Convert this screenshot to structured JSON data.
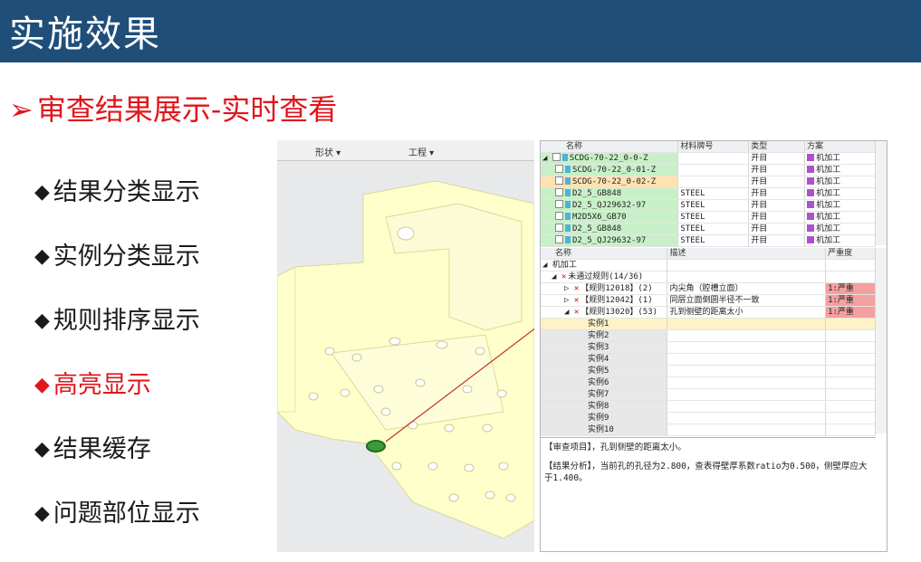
{
  "header": {
    "title": "实施效果"
  },
  "subtitle": {
    "arrow": "➢",
    "text": "审查结果展示-实时查看"
  },
  "bullets": [
    {
      "mark": "◆",
      "label": "结果分类显示",
      "active": false
    },
    {
      "mark": "◆",
      "label": "实例分类显示",
      "active": false
    },
    {
      "mark": "◆",
      "label": "规则排序显示",
      "active": false
    },
    {
      "mark": "◆",
      "label": "高亮显示",
      "active": true
    },
    {
      "mark": "◆",
      "label": "结果缓存",
      "active": false
    },
    {
      "mark": "◆",
      "label": "问题部位显示",
      "active": false
    }
  ],
  "cad": {
    "toolbar": [
      "形状 ▾",
      "工程 ▾"
    ]
  },
  "top_grid": {
    "headers": [
      "名称",
      "材料牌号",
      "类型",
      "方案"
    ],
    "rows": [
      {
        "name": "SCDG-70-22_0-0-Z",
        "material": "",
        "type": "开目",
        "plan": "机加工"
      },
      {
        "name": "SCDG-70-22_0-01-Z",
        "material": "",
        "type": "开目",
        "plan": "机加工"
      },
      {
        "name": "SCDG-70-22_0-02-Z",
        "material": "",
        "type": "开目",
        "plan": "机加工"
      },
      {
        "name": "D2_5_GB848",
        "material": "STEEL",
        "type": "开目",
        "plan": "机加工"
      },
      {
        "name": "D2_5_QJ29632-97",
        "material": "STEEL",
        "type": "开目",
        "plan": "机加工"
      },
      {
        "name": "M2D5X6_GB70",
        "material": "STEEL",
        "type": "开目",
        "plan": "机加工"
      },
      {
        "name": "D2_5_GB848",
        "material": "STEEL",
        "type": "开目",
        "plan": "机加工"
      },
      {
        "name": "D2_5_QJ29632-97",
        "material": "STEEL",
        "type": "开目",
        "plan": "机加工"
      }
    ]
  },
  "result_grid": {
    "headers": [
      "名称",
      "描述",
      "严重度"
    ],
    "group": "机加工",
    "subgroup": "未通过规则(14/36)",
    "rules": [
      {
        "name": "【规则12018】(2)",
        "desc": "内尖角（腔槽立面）",
        "severity": "1:严重"
      },
      {
        "name": "【规则12042】(1)",
        "desc": "同层立面倒圆半径不一致",
        "severity": "1:严重"
      },
      {
        "name": "【规则13020】(53)",
        "desc": "孔到侧壁的距离太小",
        "severity": "1:严重"
      }
    ],
    "instances": [
      "实例1",
      "实例2",
      "实例3",
      "实例4",
      "实例5",
      "实例6",
      "实例7",
      "实例8",
      "实例9",
      "实例10"
    ]
  },
  "description": {
    "line1": "【审查项目】，孔到侧壁的距离太小。",
    "line2": "【结果分析】，当前孔的孔径为2.800，查表得壁厚系数ratio为0.500，侧壁厚应大于1.400。"
  },
  "colors": {
    "header_bg": "#1f4e79",
    "accent_red": "#e0161c",
    "part_fill": "#ffffcc"
  }
}
